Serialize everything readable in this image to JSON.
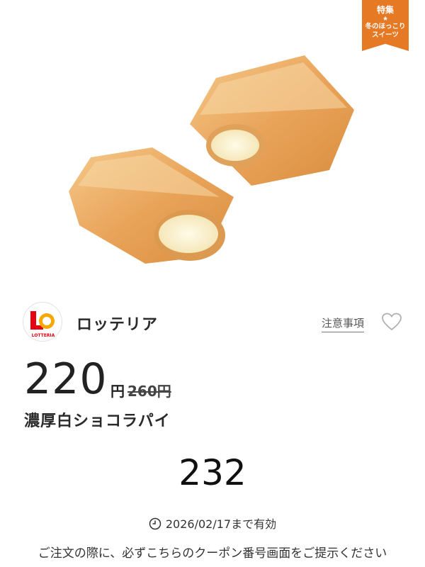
{
  "feature_tag": {
    "title": "特集",
    "star": "★",
    "subtitle_line1": "冬のほっこり",
    "subtitle_line2": "スイーツ",
    "color": "#e67924"
  },
  "brand": {
    "name": "ロッテリア",
    "logo_text": "LOTTERIA",
    "logo_colors": {
      "red": "#e60012",
      "yellow": "#f6a800"
    }
  },
  "notes_link": "注意事項",
  "favorite_icon": "heart-outline-icon",
  "price": {
    "current": "220",
    "unit": "円",
    "original": "260円"
  },
  "product_name": "濃厚白ショコラパイ",
  "coupon_number": "232",
  "validity": {
    "icon": "clock-icon",
    "text": "2026/02/17まで有効"
  },
  "instruction": "ご注文の際に、必ずこちらのクーポン番号画面をご提示ください"
}
